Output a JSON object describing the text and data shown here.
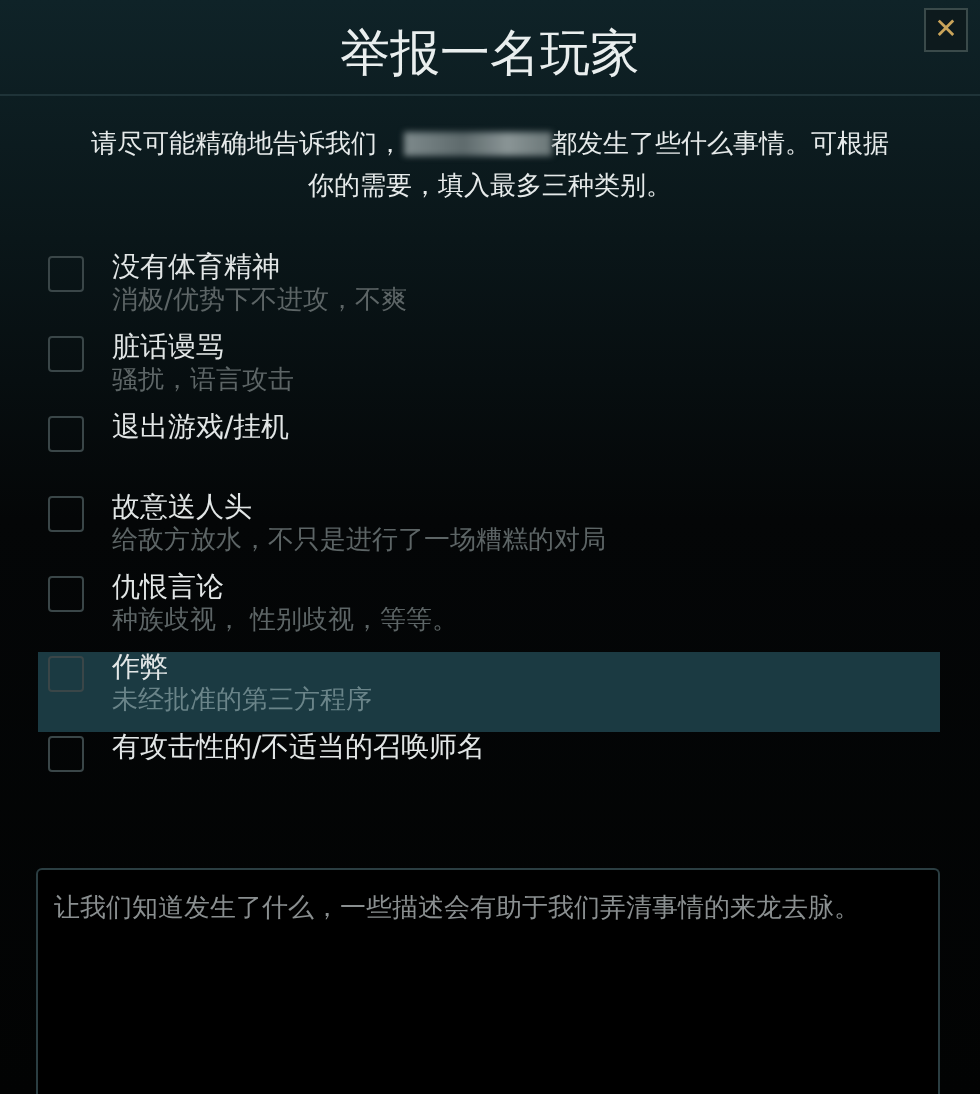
{
  "window": {
    "title": "举报一名玩家",
    "close": "✕"
  },
  "intro": {
    "before": "请尽可能精确地告诉我们，",
    "after": "都发生了些什么事情。可根据你的需要，填入最多三种类别。"
  },
  "categories": [
    {
      "label": "没有体育精神",
      "description": "消极/优势下不进攻，不爽",
      "checked": false,
      "selected": false
    },
    {
      "label": "脏话谩骂",
      "description": "骚扰，语言攻击",
      "checked": false,
      "selected": false
    },
    {
      "label": "退出游戏/挂机",
      "checked": false,
      "selected": false
    },
    {
      "label": "故意送人头",
      "description": "给敌方放水，不只是进行了一场糟糕的对局",
      "checked": false,
      "selected": false
    },
    {
      "label": "仇恨言论",
      "description": "种族歧视， 性别歧视，等等。",
      "checked": false,
      "selected": false
    },
    {
      "label": "作弊",
      "description": "未经批准的第三方程序",
      "checked": false,
      "selected": true
    },
    {
      "label": "有攻击性的/不适当的召唤师名",
      "checked": false,
      "selected": false
    }
  ],
  "comment": {
    "placeholder": "让我们知道发生了什么，一些描述会有助于我们弄清事情的来龙去脉。"
  }
}
